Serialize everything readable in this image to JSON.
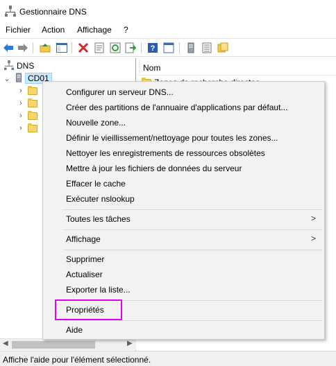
{
  "window": {
    "title": "Gestionnaire DNS"
  },
  "menubar": {
    "items": [
      "Fichier",
      "Action",
      "Affichage",
      "?"
    ]
  },
  "toolbar": {
    "icons": [
      "back-arrow-icon",
      "forward-arrow-icon",
      "up-folder-icon",
      "show-hide-tree-icon",
      "delete-icon",
      "properties-sheet-icon",
      "refresh-icon",
      "export-list-icon",
      "help-icon",
      "console-tree-icon",
      "server-icon",
      "list-icon",
      "folder-zone-icon"
    ]
  },
  "tree": {
    "root": "DNS",
    "server": "CD01",
    "children_count": 4
  },
  "right_pane": {
    "column_header": "Nom",
    "first_row_partial": "Zones de recherche directes"
  },
  "context_menu": {
    "groups": [
      [
        "Configurer un serveur DNS...",
        "Créer des partitions de l'annuaire d'applications par défaut...",
        "Nouvelle zone...",
        "Définir le vieillissement/nettoyage pour toutes les zones...",
        "Nettoyer les enregistrements de ressources obsolètes",
        "Mettre à jour les fichiers de données du serveur",
        "Effacer le cache",
        "Exécuter nslookup"
      ],
      [
        "Toutes les tâches"
      ],
      [
        "Affichage"
      ],
      [
        "Supprimer",
        "Actualiser",
        "Exporter la liste..."
      ],
      [
        "Propriétés"
      ],
      [
        "Aide"
      ]
    ],
    "submenu_indicator": ">",
    "highlighted_item": "Propriétés",
    "highlight_color": "#e800e8"
  },
  "statusbar": {
    "text": "Affiche l'aide pour l'élément sélectionné."
  }
}
